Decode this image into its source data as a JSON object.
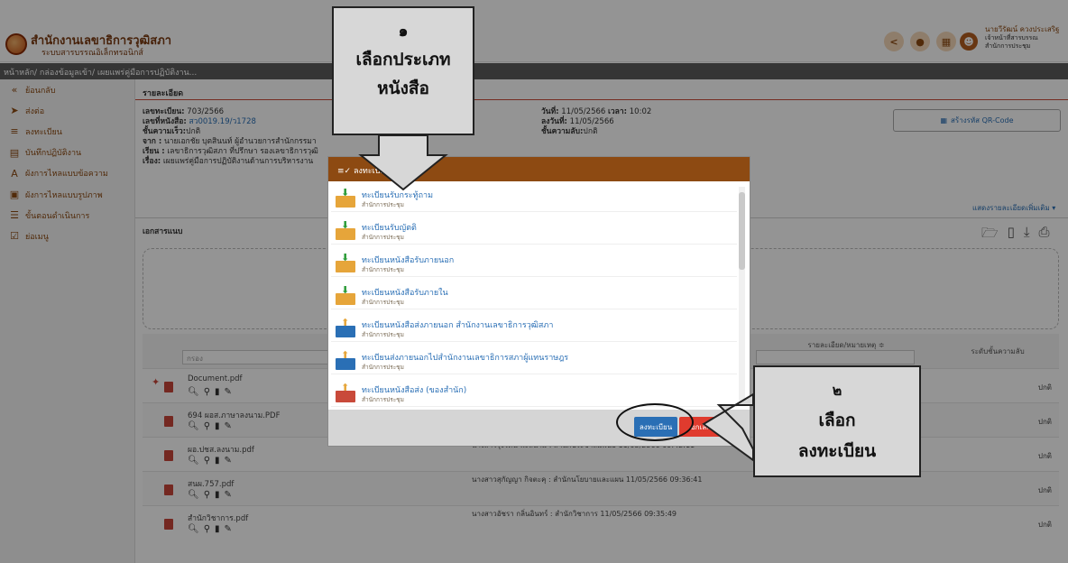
{
  "app": {
    "title": "สำนักงานเลขาธิการวุฒิสภา",
    "subtitle": "ระบบสารบรรณอิเล็กทรอนิกส์",
    "user_name": "นายวีรัฒน์ ควงประเสริฐ",
    "user_role": "เจ้าหน้าที่สารบรรณ",
    "user_office": "สำนักการประชุม"
  },
  "breadcrumb": "หน้าหลัก/ กล่องข้อมูลเข้า/ เผยแพร่คู่มือการปฏิบัติงาน...",
  "sidebar": {
    "items": [
      {
        "label": "ย้อนกลับ",
        "icon": "back-icon"
      },
      {
        "label": "ส่งต่อ",
        "icon": "send-icon"
      },
      {
        "label": "ลงทะเบียน",
        "icon": "register-icon"
      },
      {
        "label": "บันทึกปฏิบัติงาน",
        "icon": "note-icon"
      },
      {
        "label": "ผังการไหลแบบข้อความ",
        "icon": "text-flow-icon"
      },
      {
        "label": "ผังการไหลแบบรูปภาพ",
        "icon": "image-flow-icon"
      },
      {
        "label": "ขั้นตอนดำเนินการ",
        "icon": "steps-icon"
      },
      {
        "label": "ย่อเมนู",
        "icon": "collapse-icon"
      }
    ]
  },
  "detail": {
    "section_title": "รายละเอียด",
    "reg_no_label": "เลขทะเบียน:",
    "reg_no": "703/2566",
    "doc_no_label": "เลขที่หนังสือ:",
    "doc_no": "สว0019.19/ว1728",
    "urgency_label": "ชั้นความเร็ว:",
    "urgency": "ปกติ",
    "from_label": "จาก :",
    "from": "นายเอกชัย บุตสินนท์ ผู้อำนวยการสำนักกรรมา",
    "to_label": "เรียน :",
    "to": "เลขาธิการวุฒิสภา ที่ปรึกษา รองเลขาธิการวุฒิ",
    "subject_label": "เรื่อง:",
    "subject": "เผยแพร่คู่มือการปฏิบัติงานด้านการบริหารงาน",
    "date_label": "วันที่:",
    "date": "11/05/2566",
    "time_label": "เวลา:",
    "time": "10:02",
    "reg_date_label": "ลงวันที่:",
    "reg_date": "11/05/2566",
    "secret_label": "ชั้นความลับ:",
    "secret": "ปกติ",
    "qr_button": "สร้างรหัส QR-Code",
    "more_link": "แสดงรายละเอียดเพิ่มเติม ▾"
  },
  "attachments": {
    "section_title": "เอกสารแนบ",
    "filter_placeholder": "กรอง",
    "col_detail": "รายละเอียด/หมายเหตุ ≑",
    "col_level": "ระดับชั้นความลับ",
    "rows": [
      {
        "name": "Document.pdf",
        "info": "",
        "level": "ปกติ"
      },
      {
        "name": "694 ผอส.ภาษาลงนาม.PDF",
        "info": "",
        "level": "ปกติ"
      },
      {
        "name": "ผอ.ปชส.ลงนาม.pdf",
        "info": "นางสาวรุ่งรัตน์ พะลีนาม : สำนักประชาสัมพันธ์ 11/05/2566 09:42:11",
        "level": "ปกติ"
      },
      {
        "name": "สนผ.757.pdf",
        "info": "นางสาวสุกัญญา กิจตะคุ : สำนักนโยบายและแผน 11/05/2566 09:36:41",
        "level": "ปกติ"
      },
      {
        "name": "สำนักวิชาการ.pdf",
        "info": "นางสาวอัชรา กลิ่นอินทร์ : สำนักวิชาการ 11/05/2566 09:35:49",
        "level": "ปกติ"
      }
    ]
  },
  "modal": {
    "title": "ลงทะเบียน",
    "items": [
      {
        "title": "ทะเบียนรับกระทู้ถาม",
        "sub": "สำนักการประชุม",
        "type": "receive"
      },
      {
        "title": "ทะเบียนรับญัตติ",
        "sub": "สำนักการประชุม",
        "type": "receive"
      },
      {
        "title": "ทะเบียนหนังสือรับภายนอก",
        "sub": "สำนักการประชุม",
        "type": "receive"
      },
      {
        "title": "ทะเบียนหนังสือรับภายใน",
        "sub": "สำนักการประชุม",
        "type": "receive"
      },
      {
        "title": "ทะเบียนหนังสือส่งภายนอก สำนักงานเลขาธิการวุฒิสภา",
        "sub": "สำนักการประชุม",
        "type": "send"
      },
      {
        "title": "ทะเบียนส่งภายนอกไปสำนักงานเลขาธิการสภาผู้แทนราษฎร",
        "sub": "สำนักการประชุม",
        "type": "send"
      },
      {
        "title": "ทะเบียนหนังสือส่ง (ของสำนัก)",
        "sub": "สำนักการประชุม",
        "type": "send"
      }
    ],
    "register_button": "ลงทะเบียน",
    "cancel_button": "ยกเลิก"
  },
  "callouts": {
    "step1_number": "๑",
    "step1_line1": "เลือกประเภท",
    "step1_line2": "หนังสือ",
    "step2_number": "๒",
    "step2_line1": "เลือก",
    "step2_line2": "ลงทะเบียน"
  },
  "colors": {
    "brand": "#8d4a12",
    "link": "#2a6fb5",
    "cancel": "#e03b2e",
    "callout_bg": "#d7d7d7"
  }
}
